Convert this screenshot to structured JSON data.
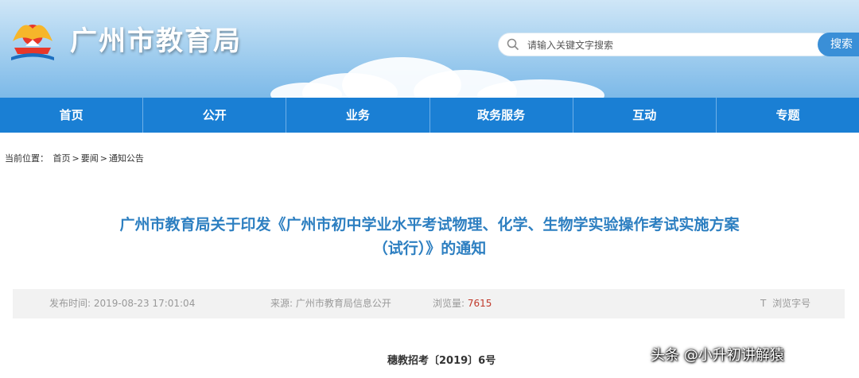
{
  "site": {
    "title": "广州市教育局"
  },
  "search": {
    "placeholder": "请输入关键文字搜索",
    "button_label": "搜索"
  },
  "nav": {
    "items": [
      "首页",
      "公开",
      "业务",
      "政务服务",
      "互动",
      "专题"
    ]
  },
  "breadcrumb": {
    "prefix": "当前位置：",
    "path": [
      "首页",
      "要闻",
      "通知公告"
    ],
    "separator": ">"
  },
  "article": {
    "title_line1": "广州市教育局关于印发《广州市初中学业水平考试物理、化学、生物学实验操作考试实施方案",
    "title_line2": "（试行）》的通知",
    "publish_label": "发布时间:",
    "publish_time": "2019-08-23 17:01:04",
    "source_label": "来源:",
    "source": "广州市教育局信息公开",
    "views_label": "浏览量:",
    "views": "7615",
    "font_size_icon": "T",
    "font_size_label": "浏览字号",
    "doc_number": "穗教招考〔2019〕6号"
  },
  "watermark": {
    "text": "头条 @小升初讲解猿"
  },
  "colors": {
    "nav_bg": "#1a7fd4",
    "title": "#2d7fc1",
    "views": "#c0392b"
  }
}
